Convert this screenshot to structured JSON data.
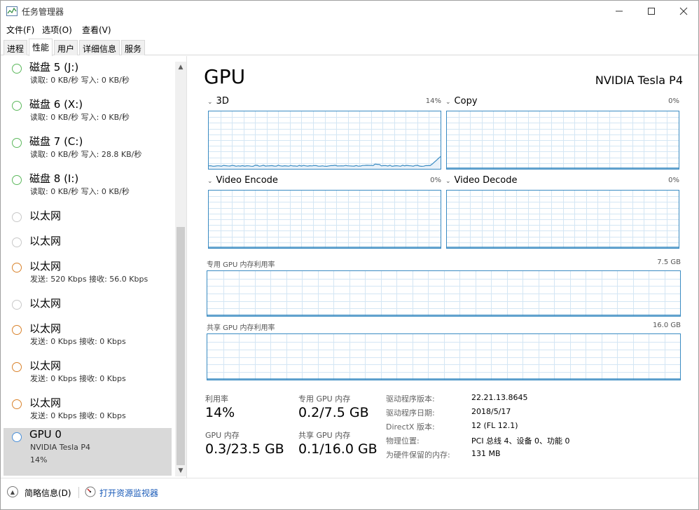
{
  "window": {
    "title": "任务管理器"
  },
  "menu": [
    "文件(F)",
    "选项(O)",
    "查看(V)"
  ],
  "tabs": [
    {
      "label": "进程",
      "active": false
    },
    {
      "label": "性能",
      "active": true
    },
    {
      "label": "用户",
      "active": false
    },
    {
      "label": "详细信息",
      "active": false
    },
    {
      "label": "服务",
      "active": false
    }
  ],
  "sidebar": {
    "items": [
      {
        "name": "磁盘 5 (J:)",
        "sub": "读取: 0 KB/秒 写入: 0 KB/秒",
        "circle_color": "#5cb85c"
      },
      {
        "name": "磁盘 6 (X:)",
        "sub": "读取: 0 KB/秒 写入: 0 KB/秒",
        "circle_color": "#5cb85c"
      },
      {
        "name": "磁盘 7 (C:)",
        "sub": "读取: 0 KB/秒 写入: 28.8 KB/秒",
        "circle_color": "#5cb85c"
      },
      {
        "name": "磁盘 8 (I:)",
        "sub": "读取: 0 KB/秒 写入: 0 KB/秒",
        "circle_color": "#5cb85c"
      },
      {
        "name": "以太网",
        "sub": "",
        "circle_color": "#c8c8c8"
      },
      {
        "name": "以太网",
        "sub": "",
        "circle_color": "#c8c8c8"
      },
      {
        "name": "以太网",
        "sub": "发送: 520 Kbps 接收: 56.0 Kbps",
        "circle_color": "#d9822b"
      },
      {
        "name": "以太网",
        "sub": "",
        "circle_color": "#c8c8c8"
      },
      {
        "name": "以太网",
        "sub": "发送: 0 Kbps 接收: 0 Kbps",
        "circle_color": "#d9822b"
      },
      {
        "name": "以太网",
        "sub": "发送: 0 Kbps 接收: 0 Kbps",
        "circle_color": "#d9822b"
      },
      {
        "name": "以太网",
        "sub": "发送: 0 Kbps 接收: 0 Kbps",
        "circle_color": "#d9822b"
      },
      {
        "name": "GPU 0",
        "sub": "NVIDIA Tesla P4",
        "sub2": "14%",
        "circle_color": "#4a90d9",
        "selected": true
      }
    ]
  },
  "main": {
    "title": "GPU",
    "model": "NVIDIA Tesla P4",
    "graphs": [
      {
        "label": "3D",
        "pct": "14%"
      },
      {
        "label": "Copy",
        "pct": "0%"
      },
      {
        "label": "Video Encode",
        "pct": "0%"
      },
      {
        "label": "Video Decode",
        "pct": "0%"
      }
    ],
    "dedicated_mem": {
      "label": "专用 GPU 内存利用率",
      "cap": "7.5 GB"
    },
    "shared_mem": {
      "label": "共享 GPU 内存利用率",
      "cap": "16.0 GB"
    },
    "stats": {
      "utilization_label": "利用率",
      "utilization_value": "14%",
      "dedicated_label": "专用 GPU 内存",
      "dedicated_value": "0.2/7.5 GB",
      "gpu_mem_label": "GPU 内存",
      "gpu_mem_value": "0.3/23.5 GB",
      "shared_label": "共享 GPU 内存",
      "shared_value": "0.1/16.0 GB"
    },
    "info": [
      {
        "label": "驱动程序版本:",
        "value": "22.21.13.8645"
      },
      {
        "label": "驱动程序日期:",
        "value": "2018/5/17"
      },
      {
        "label": "DirectX 版本:",
        "value": "12 (FL 12.1)"
      },
      {
        "label": "物理位置:",
        "value": "PCI 总线 4、设备 0、功能 0"
      },
      {
        "label": "为硬件保留的内存:",
        "value": "131 MB"
      }
    ]
  },
  "footer": {
    "fewer_details": "简略信息(D)",
    "open_monitor": "打开资源监视器"
  },
  "colors": {
    "graph_border": "#3a8bc2",
    "graph_grid": "#d4e6f4",
    "graph_line": "#3a8bc2",
    "link": "#1a5bb8"
  }
}
